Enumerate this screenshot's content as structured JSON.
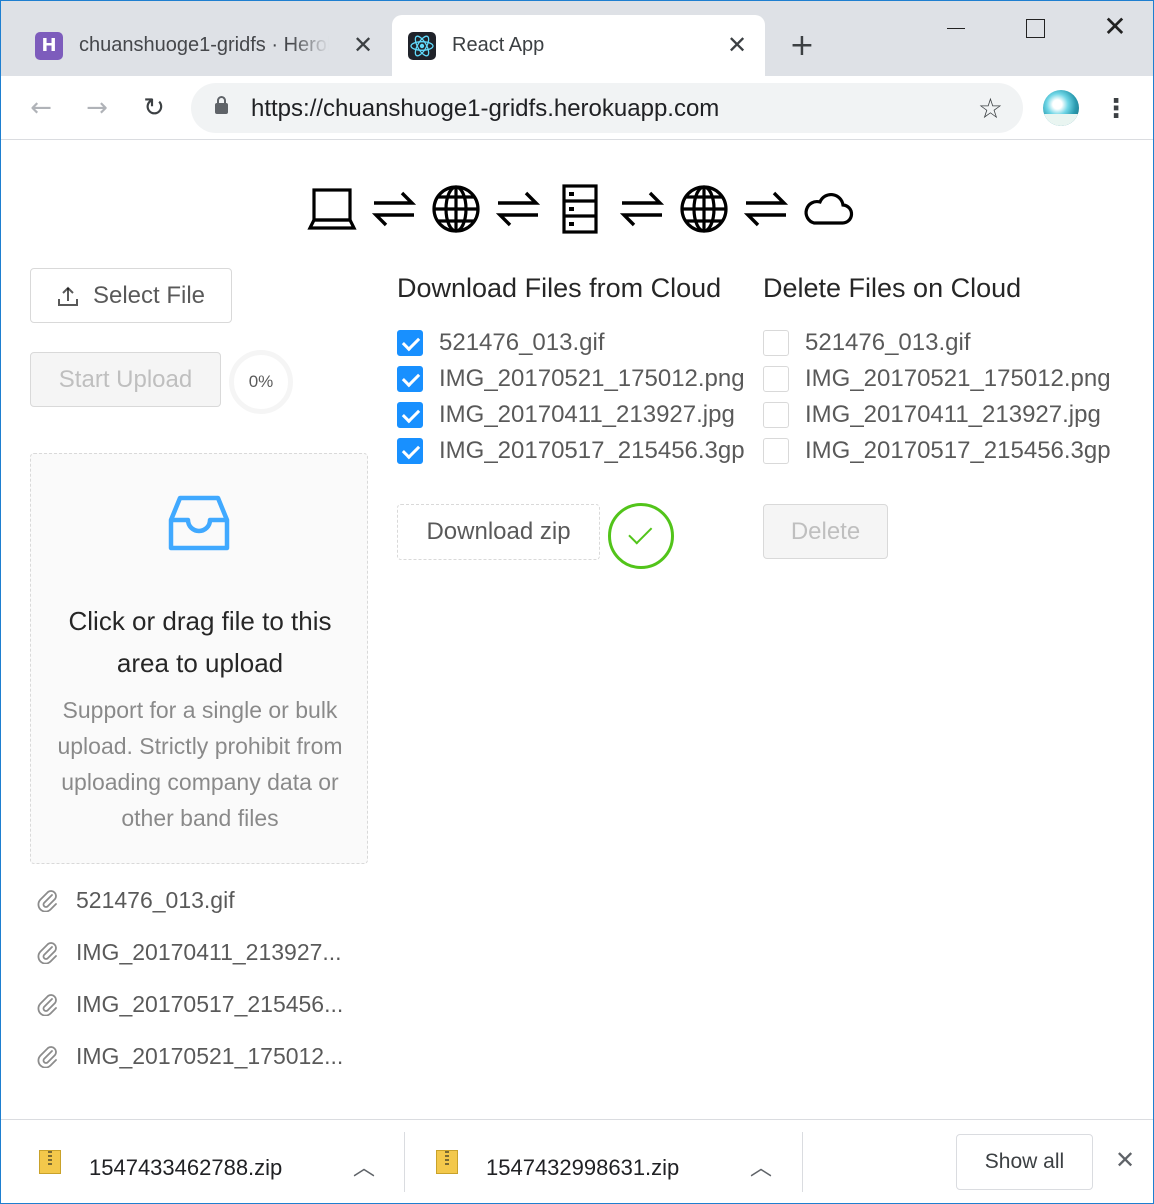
{
  "browser": {
    "tabs": [
      {
        "title": "chuanshuoge1-gridfs · Heroku",
        "favicon": "H",
        "active": false
      },
      {
        "title": "React App",
        "favicon": "react-logo",
        "active": true
      }
    ],
    "url": "https://chuanshuoge1-gridfs.herokuapp.com"
  },
  "hero": {
    "icons": [
      "laptop-icon",
      "exchange-icon",
      "globe-icon",
      "exchange-icon",
      "database-icon",
      "exchange-icon",
      "globe-icon",
      "exchange-icon",
      "cloud-icon"
    ]
  },
  "upload": {
    "select_label": "Select File",
    "start_label": "Start Upload",
    "progress": "0%",
    "drag_text": "Click or drag file to this area to upload",
    "hint": "Support for a single or bulk upload. Strictly prohibit from uploading company data or other band files",
    "files": [
      "521476_013.gif",
      "IMG_20170411_213927...",
      "IMG_20170517_215456...",
      "IMG_20170521_175012..."
    ]
  },
  "download": {
    "title": "Download Files from Cloud",
    "items": [
      {
        "name": "521476_013.gif",
        "checked": true
      },
      {
        "name": "IMG_20170521_175012.png",
        "checked": true
      },
      {
        "name": "IMG_20170411_213927.jpg",
        "checked": true
      },
      {
        "name": "IMG_20170517_215456.3gp",
        "checked": true
      }
    ],
    "button": "Download zip"
  },
  "delete": {
    "title": "Delete Files on Cloud",
    "items": [
      {
        "name": "521476_013.gif",
        "checked": false
      },
      {
        "name": "IMG_20170521_175012.png",
        "checked": false
      },
      {
        "name": "IMG_20170411_213927.jpg",
        "checked": false
      },
      {
        "name": "IMG_20170517_215456.3gp",
        "checked": false
      }
    ],
    "button": "Delete"
  },
  "shelf": {
    "downloads": [
      "1547433462788.zip",
      "1547432998631.zip"
    ],
    "show_all": "Show all"
  },
  "colors": {
    "primary": "#1890ff",
    "success": "#52c41a",
    "border": "#d9d9d9",
    "tabstrip": "#dee1e6"
  }
}
